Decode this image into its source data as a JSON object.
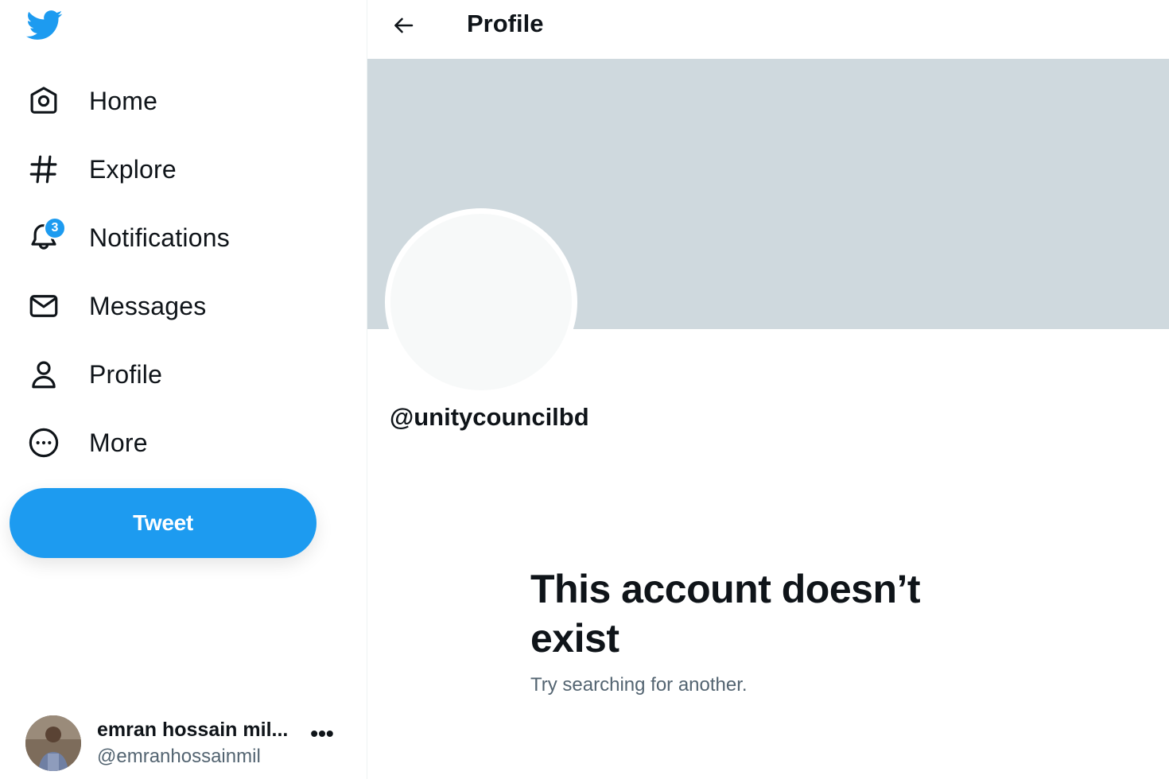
{
  "sidebar": {
    "logo": "twitter-bird-icon",
    "items": [
      {
        "label": "Home",
        "icon": "home-icon"
      },
      {
        "label": "Explore",
        "icon": "hashtag-icon"
      },
      {
        "label": "Notifications",
        "icon": "bell-icon",
        "badge": "3"
      },
      {
        "label": "Messages",
        "icon": "envelope-icon"
      },
      {
        "label": "Profile",
        "icon": "person-icon"
      },
      {
        "label": "More",
        "icon": "more-circle-icon"
      }
    ],
    "tweet_label": "Tweet",
    "account": {
      "name": "emran hossain mil...",
      "handle": "@emranhossainmil",
      "more": "•••"
    }
  },
  "main": {
    "header_title": "Profile",
    "handle": "@unitycouncilbd",
    "empty_title": "This account doesn’t exist",
    "empty_subtitle": "Try searching for another."
  },
  "colors": {
    "accent": "#1d9bf0",
    "banner": "#cfd9de",
    "text": "#0f1419",
    "muted": "#536471"
  }
}
